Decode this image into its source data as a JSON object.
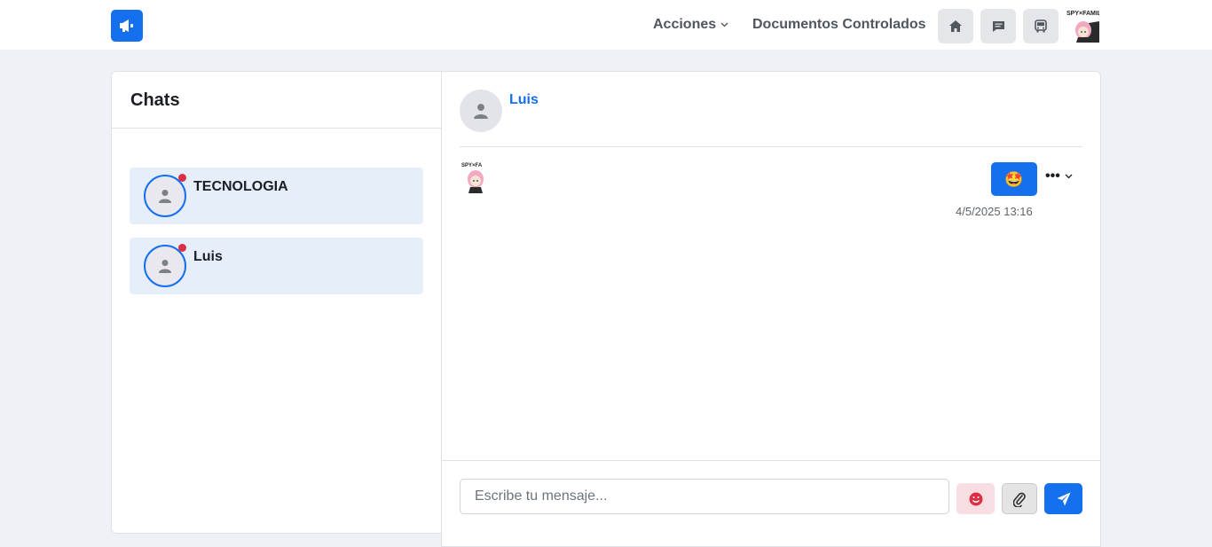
{
  "nav": {
    "logo_icon": "megaphone-icon",
    "links": [
      {
        "label": "Acciones",
        "icon": "chevron-down-icon"
      },
      {
        "label": "Documentos Controlados"
      }
    ],
    "icon_buttons": [
      "home-icon",
      "message-icon",
      "bus-icon"
    ],
    "user_avatar": "anime-avatar"
  },
  "chats": {
    "title": "Chats",
    "items": [
      {
        "name": "TECNOLOGIA",
        "online": true
      },
      {
        "name": "Luis",
        "online": true
      }
    ]
  },
  "conversation": {
    "contact_name": "Luis",
    "messages": [
      {
        "content": "🤩",
        "timestamp": "4/5/2025 13:16",
        "menu": "•••"
      }
    ],
    "input": {
      "placeholder": "Escribe tu mensaje...",
      "value": ""
    },
    "actions": [
      "emoji-icon",
      "paperclip-icon",
      "send-icon"
    ]
  },
  "colors": {
    "accent": "#1570ef",
    "online": "#dc2f45",
    "selected_bg": "#e6eefa",
    "page_bg": "#eef1f6"
  }
}
